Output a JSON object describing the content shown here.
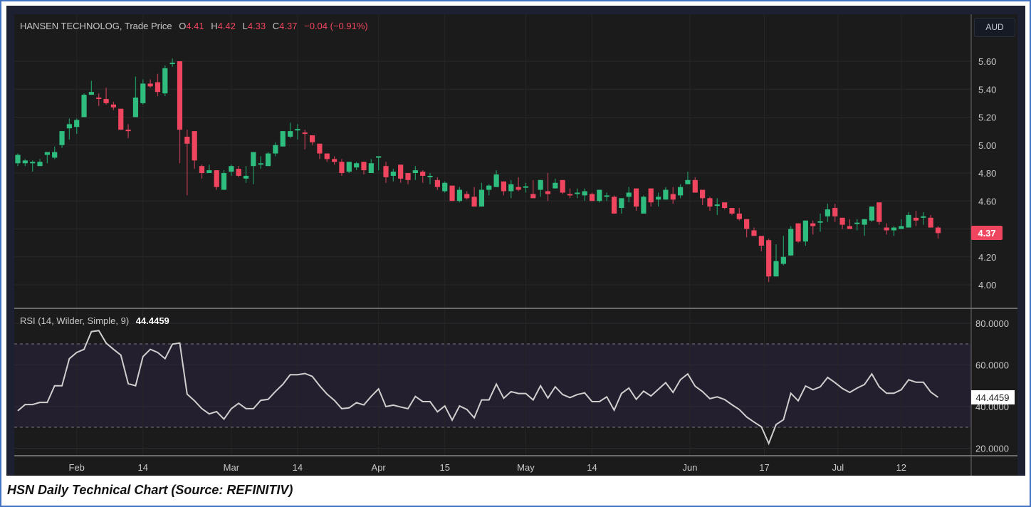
{
  "header": {
    "symbol": "HANSEN TECHNOLOG, Trade Price",
    "o_label": "O",
    "o_value": "4.41",
    "h_label": "H",
    "h_value": "4.42",
    "l_label": "L",
    "l_value": "4.33",
    "c_label": "C",
    "c_value": "4.37",
    "change": "−0.04 (−0.91%)"
  },
  "currency_button": "AUD",
  "last_price_label": "4.37",
  "rsi_header": {
    "title": "RSI (14, Wilder, Simple, 9)",
    "value": "44.4459"
  },
  "rsi_value_label": "44.4459",
  "caption": "HSN Daily Technical Chart (Source: REFINITIV)",
  "colors": {
    "up": "#2ebd7f",
    "down": "#f0455f",
    "background": "#1b1b1b",
    "rsi_line": "#cfcfcf",
    "rsi_band": "#241f2e"
  },
  "chart_data": [
    {
      "type": "candlestick",
      "title": "HANSEN TECHNOLOG, Trade Price",
      "ylabel": "AUD",
      "ylim": [
        3.93,
        5.73
      ],
      "y_ticks": [
        "4.00",
        "4.20",
        "4.40",
        "4.60",
        "4.80",
        "5.00",
        "5.20",
        "5.40",
        "5.60"
      ],
      "x_ticks": [
        {
          "label": "Feb",
          "index": 9
        },
        {
          "label": "14",
          "index": 18
        },
        {
          "label": "Mar",
          "index": 30
        },
        {
          "label": "14",
          "index": 39
        },
        {
          "label": "Apr",
          "index": 50
        },
        {
          "label": "15",
          "index": 59
        },
        {
          "label": "May",
          "index": 70
        },
        {
          "label": "14",
          "index": 79
        },
        {
          "label": "Jun",
          "index": 92.3
        },
        {
          "label": "17",
          "index": 102.4
        },
        {
          "label": "Jul",
          "index": 112.4
        },
        {
          "label": "12",
          "index": 121
        }
      ],
      "ohlc_fields": [
        "open",
        "high",
        "low",
        "close"
      ],
      "ohlc": [
        [
          4.87,
          4.94,
          4.85,
          4.93
        ],
        [
          4.87,
          4.9,
          4.85,
          4.89
        ],
        [
          4.87,
          4.89,
          4.81,
          4.88
        ],
        [
          4.85,
          4.9,
          4.85,
          4.88
        ],
        [
          4.93,
          4.95,
          4.87,
          4.95
        ],
        [
          4.91,
          4.99,
          4.9,
          4.95
        ],
        [
          5.0,
          5.1,
          4.98,
          5.1
        ],
        [
          5.12,
          5.19,
          5.04,
          5.15
        ],
        [
          5.13,
          5.19,
          5.08,
          5.18
        ],
        [
          5.2,
          5.37,
          5.2,
          5.36
        ],
        [
          5.36,
          5.46,
          5.36,
          5.38
        ],
        [
          5.34,
          5.37,
          5.28,
          5.33
        ],
        [
          5.33,
          5.41,
          5.29,
          5.3
        ],
        [
          5.29,
          5.31,
          5.25,
          5.27
        ],
        [
          5.26,
          5.26,
          5.11,
          5.11
        ],
        [
          5.11,
          5.15,
          5.05,
          5.1
        ],
        [
          5.2,
          5.49,
          5.2,
          5.34
        ],
        [
          5.3,
          5.47,
          5.29,
          5.44
        ],
        [
          5.44,
          5.47,
          5.41,
          5.42
        ],
        [
          5.45,
          5.51,
          5.35,
          5.38
        ],
        [
          5.37,
          5.57,
          5.35,
          5.55
        ],
        [
          5.58,
          5.62,
          5.56,
          5.59
        ],
        [
          5.6,
          5.6,
          4.87,
          5.11
        ],
        [
          5.06,
          5.11,
          4.64,
          5.01
        ],
        [
          5.1,
          5.1,
          4.83,
          4.89
        ],
        [
          4.85,
          4.86,
          4.76,
          4.8
        ],
        [
          4.8,
          4.86,
          4.8,
          4.82
        ],
        [
          4.82,
          4.82,
          4.68,
          4.7
        ],
        [
          4.68,
          4.82,
          4.68,
          4.8
        ],
        [
          4.81,
          4.86,
          4.78,
          4.85
        ],
        [
          4.83,
          4.85,
          4.77,
          4.78
        ],
        [
          4.76,
          4.85,
          4.73,
          4.78
        ],
        [
          4.85,
          4.95,
          4.72,
          4.95
        ],
        [
          4.86,
          4.92,
          4.83,
          4.87
        ],
        [
          4.85,
          4.95,
          4.85,
          4.94
        ],
        [
          4.94,
          5.02,
          4.92,
          5.0
        ],
        [
          4.99,
          5.1,
          4.99,
          5.1
        ],
        [
          5.06,
          5.16,
          5.05,
          5.1
        ],
        [
          5.11,
          5.15,
          5.04,
          5.115
        ],
        [
          5.09,
          5.11,
          4.97,
          5.085
        ],
        [
          5.07,
          5.07,
          5.0,
          5.02
        ],
        [
          5.01,
          5.01,
          4.9,
          4.94
        ],
        [
          4.94,
          4.94,
          4.88,
          4.9
        ],
        [
          4.9,
          4.92,
          4.86,
          4.88
        ],
        [
          4.88,
          4.9,
          4.78,
          4.8
        ],
        [
          4.81,
          4.88,
          4.8,
          4.88
        ],
        [
          4.84,
          4.88,
          4.82,
          4.87
        ],
        [
          4.88,
          4.88,
          4.79,
          4.82
        ],
        [
          4.8,
          4.9,
          4.8,
          4.87
        ],
        [
          4.91,
          4.92,
          4.82,
          4.92
        ],
        [
          4.85,
          4.88,
          4.73,
          4.77
        ],
        [
          4.78,
          4.83,
          4.74,
          4.81
        ],
        [
          4.86,
          4.86,
          4.73,
          4.76
        ],
        [
          4.8,
          4.8,
          4.72,
          4.75
        ],
        [
          4.8,
          4.85,
          4.75,
          4.82
        ],
        [
          4.81,
          4.82,
          4.73,
          4.78
        ],
        [
          4.77,
          4.8,
          4.72,
          4.78
        ],
        [
          4.75,
          4.77,
          4.68,
          4.7
        ],
        [
          4.67,
          4.74,
          4.66,
          4.73
        ],
        [
          4.71,
          4.71,
          4.6,
          4.6
        ],
        [
          4.6,
          4.7,
          4.59,
          4.68
        ],
        [
          4.65,
          4.67,
          4.61,
          4.62
        ],
        [
          4.63,
          4.7,
          4.56,
          4.56
        ],
        [
          4.56,
          4.73,
          4.56,
          4.68
        ],
        [
          4.68,
          4.72,
          4.64,
          4.71
        ],
        [
          4.7,
          4.82,
          4.7,
          4.79
        ],
        [
          4.74,
          4.74,
          4.64,
          4.67
        ],
        [
          4.67,
          4.75,
          4.62,
          4.72
        ],
        [
          4.7,
          4.77,
          4.67,
          4.68
        ],
        [
          4.7,
          4.73,
          4.66,
          4.705
        ],
        [
          4.65,
          4.75,
          4.62,
          4.62
        ],
        [
          4.68,
          4.75,
          4.63,
          4.75
        ],
        [
          4.67,
          4.8,
          4.6,
          4.65
        ],
        [
          4.69,
          4.76,
          4.69,
          4.73
        ],
        [
          4.75,
          4.75,
          4.65,
          4.66
        ],
        [
          4.65,
          4.69,
          4.62,
          4.64
        ],
        [
          4.65,
          4.69,
          4.62,
          4.66
        ],
        [
          4.64,
          4.69,
          4.6,
          4.67
        ],
        [
          4.65,
          4.66,
          4.6,
          4.6
        ],
        [
          4.6,
          4.68,
          4.59,
          4.68
        ],
        [
          4.63,
          4.66,
          4.6,
          4.64
        ],
        [
          4.63,
          4.64,
          4.51,
          4.51
        ],
        [
          4.55,
          4.62,
          4.51,
          4.62
        ],
        [
          4.63,
          4.7,
          4.59,
          4.66
        ],
        [
          4.69,
          4.69,
          4.53,
          4.56
        ],
        [
          4.51,
          4.64,
          4.51,
          4.63
        ],
        [
          4.69,
          4.69,
          4.56,
          4.59
        ],
        [
          4.61,
          4.66,
          4.56,
          4.63
        ],
        [
          4.61,
          4.7,
          4.61,
          4.68
        ],
        [
          4.65,
          4.7,
          4.58,
          4.61
        ],
        [
          4.64,
          4.72,
          4.62,
          4.7
        ],
        [
          4.72,
          4.81,
          4.72,
          4.75
        ],
        [
          4.75,
          4.77,
          4.66,
          4.66
        ],
        [
          4.68,
          4.68,
          4.57,
          4.62
        ],
        [
          4.62,
          4.63,
          4.53,
          4.56
        ],
        [
          4.57,
          4.62,
          4.5,
          4.575
        ],
        [
          4.59,
          4.59,
          4.54,
          4.55
        ],
        [
          4.55,
          4.55,
          4.5,
          4.51
        ],
        [
          4.51,
          4.55,
          4.46,
          4.47
        ],
        [
          4.47,
          4.47,
          4.34,
          4.4
        ],
        [
          4.39,
          4.41,
          4.35,
          4.35
        ],
        [
          4.35,
          4.35,
          4.24,
          4.28
        ],
        [
          4.32,
          4.33,
          4.02,
          4.06
        ],
        [
          4.06,
          4.29,
          4.06,
          4.17
        ],
        [
          4.15,
          4.35,
          4.14,
          4.2
        ],
        [
          4.21,
          4.42,
          4.21,
          4.4
        ],
        [
          4.44,
          4.44,
          4.3,
          4.31
        ],
        [
          4.31,
          4.46,
          4.28,
          4.46
        ],
        [
          4.44,
          4.46,
          4.36,
          4.42
        ],
        [
          4.45,
          4.51,
          4.38,
          4.455
        ],
        [
          4.49,
          4.58,
          4.45,
          4.54
        ],
        [
          4.55,
          4.58,
          4.45,
          4.49
        ],
        [
          4.48,
          4.48,
          4.4,
          4.43
        ],
        [
          4.42,
          4.47,
          4.4,
          4.4
        ],
        [
          4.44,
          4.47,
          4.39,
          4.445
        ],
        [
          4.43,
          4.47,
          4.35,
          4.47
        ],
        [
          4.46,
          4.56,
          4.45,
          4.56
        ],
        [
          4.59,
          4.59,
          4.43,
          4.45
        ],
        [
          4.41,
          4.44,
          4.36,
          4.39
        ],
        [
          4.39,
          4.42,
          4.35,
          4.41
        ],
        [
          4.4,
          4.47,
          4.4,
          4.42
        ],
        [
          4.41,
          4.52,
          4.41,
          4.5
        ],
        [
          4.48,
          4.53,
          4.42,
          4.46
        ],
        [
          4.48,
          4.52,
          4.43,
          4.49
        ],
        [
          4.48,
          4.5,
          4.41,
          4.41
        ],
        [
          4.41,
          4.42,
          4.33,
          4.37
        ]
      ]
    },
    {
      "type": "line",
      "title": "RSI (14, Wilder, Simple, 9)",
      "ylim": [
        17,
        87
      ],
      "y_ticks": [
        "20.0000",
        "40.0000",
        "60.0000",
        "80.0000"
      ],
      "overbought": 70,
      "oversold": 30,
      "values": [
        38,
        41,
        41,
        42,
        42,
        50,
        50,
        63,
        66,
        67.5,
        76,
        76.5,
        70.5,
        67.5,
        64.7,
        51,
        50,
        64,
        67.5,
        66,
        63,
        70,
        70.5,
        46,
        42.8,
        39,
        36.5,
        37.6,
        34,
        39,
        41.6,
        39,
        39,
        43,
        43.5,
        47.3,
        50.7,
        55.3,
        55.3,
        55.9,
        54.5,
        50,
        46,
        43,
        39,
        39.4,
        41.9,
        40.8,
        44.9,
        48.5,
        40,
        40.7,
        39.8,
        39,
        44.9,
        42.4,
        42.4,
        37.5,
        40.3,
        33.5,
        40.3,
        38.6,
        34.6,
        43.2,
        43.2,
        50.8,
        44,
        47.2,
        46.3,
        46.3,
        43.2,
        50,
        44.1,
        49.5,
        45.8,
        44.3,
        45.8,
        46.6,
        42.4,
        42.4,
        44.7,
        38.3,
        46.3,
        48.9,
        43.5,
        47.4,
        45.1,
        48.3,
        51.5,
        46.8,
        52.9,
        55.7,
        49.8,
        47.2,
        43.8,
        44.7,
        43.4,
        40.9,
        38.6,
        35,
        32.6,
        30.3,
        22.3,
        31.4,
        33.7,
        46.4,
        42.8,
        49.9,
        48.1,
        49.5,
        54,
        51.5,
        48.7,
        46.8,
        48.9,
        50.6,
        55.7,
        49.5,
        46.4,
        46.4,
        48.1,
        52.9,
        51.7,
        51.7,
        47,
        44.4459
      ]
    }
  ]
}
